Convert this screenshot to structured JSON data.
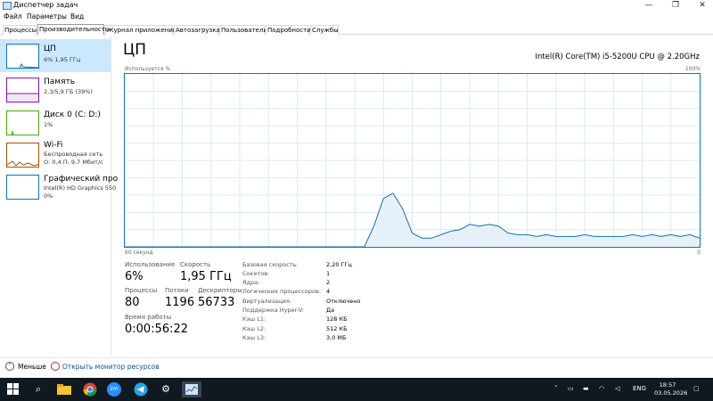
{
  "window": {
    "title": "Диспетчер задач",
    "minimize_glyph": "—",
    "maximize_glyph": "❐",
    "close_glyph": "✕"
  },
  "menu": [
    "Файл",
    "Параметры",
    "Вид"
  ],
  "tabs": [
    {
      "label": "Процессы"
    },
    {
      "label": "Производительность",
      "active": true
    },
    {
      "label": "Журнал приложений"
    },
    {
      "label": "Автозагрузка"
    },
    {
      "label": "Пользователи"
    },
    {
      "label": "Подробности"
    },
    {
      "label": "Службы"
    }
  ],
  "sidebar": {
    "items": [
      {
        "title": "ЦП",
        "sub1": "6% 1,95 ГГц",
        "sub2": "",
        "color": "#1172b4",
        "active": true
      },
      {
        "title": "Память",
        "sub1": "2,3/5,9 ГБ (39%)",
        "sub2": "",
        "color": "#8b12ae"
      },
      {
        "title": "Диск 0 (C: D:)",
        "sub1": "1%",
        "sub2": "",
        "color": "#4da60c"
      },
      {
        "title": "Wi-Fi",
        "sub1": "Беспроводная сеть",
        "sub2": "О: 0,4 П: 9,7 Мбит/с",
        "color": "#a74f01"
      },
      {
        "title": "Графический про",
        "sub1": "Intel(R) HD Graphics 550",
        "sub2": "0%",
        "color": "#1172b4"
      }
    ]
  },
  "main": {
    "title": "ЦП",
    "cpu_name": "Intel(R) Core(TM) i5-5200U CPU @ 2.20GHz",
    "graph_top_left": "Используется %",
    "graph_top_right": "100%",
    "graph_bottom_left": "60 секунд",
    "graph_bottom_right": "0"
  },
  "chart_data": {
    "type": "area",
    "ylim": [
      0,
      100
    ],
    "xlim": [
      60,
      0
    ],
    "grid": true,
    "color": "#1172b4",
    "fill": "#e6f1fb",
    "x": [
      60,
      50,
      35,
      34,
      33,
      32,
      31,
      30,
      29,
      28,
      27,
      26,
      25,
      24,
      23,
      22,
      21,
      20,
      19,
      18,
      17,
      16,
      15,
      14,
      13,
      12,
      11,
      10,
      9,
      8,
      7,
      6,
      5,
      4,
      3,
      2,
      1,
      0
    ],
    "values": [
      0,
      0,
      0,
      12,
      28,
      31,
      22,
      8,
      5,
      5,
      7,
      9,
      10,
      13,
      12,
      13,
      12,
      8,
      7,
      7,
      6,
      7,
      6,
      6,
      6,
      7,
      6,
      6,
      6,
      6,
      7,
      6,
      7,
      6,
      7,
      6,
      7,
      5
    ]
  },
  "stats": {
    "usage_label": "Использование",
    "usage_value": "6%",
    "speed_label": "Скорость",
    "speed_value": "1,95 ГГц",
    "processes_label": "Процессы",
    "processes_value": "80",
    "threads_label": "Потоки",
    "threads_value": "1196",
    "handles_label": "Дескрипторы",
    "handles_value": "56733",
    "uptime_label": "Время работы",
    "uptime_value": "0:00:56:22"
  },
  "specs": [
    {
      "label": "Базовая скорость:",
      "value": "2,20 ГГц"
    },
    {
      "label": "Сокетов:",
      "value": "1"
    },
    {
      "label": "Ядра:",
      "value": "2"
    },
    {
      "label": "Логических процессоров:",
      "value": "4"
    },
    {
      "label": "Виртуализация:",
      "value": "Отключено"
    },
    {
      "label": "Поддержка Hyper-V:",
      "value": "Да"
    },
    {
      "label": "Кэш L1:",
      "value": "128 КБ"
    },
    {
      "label": "Кэш L2:",
      "value": "512 КБ"
    },
    {
      "label": "Кэш L3:",
      "value": "3,0 МБ"
    }
  ],
  "footer": {
    "fewer_label": "Меньше",
    "resmon_label": "Открыть монитор ресурсов"
  },
  "taskbar": {
    "zoom_label": "zm",
    "lang": "ENG",
    "time": "18:57",
    "date": "03.05.2026"
  }
}
